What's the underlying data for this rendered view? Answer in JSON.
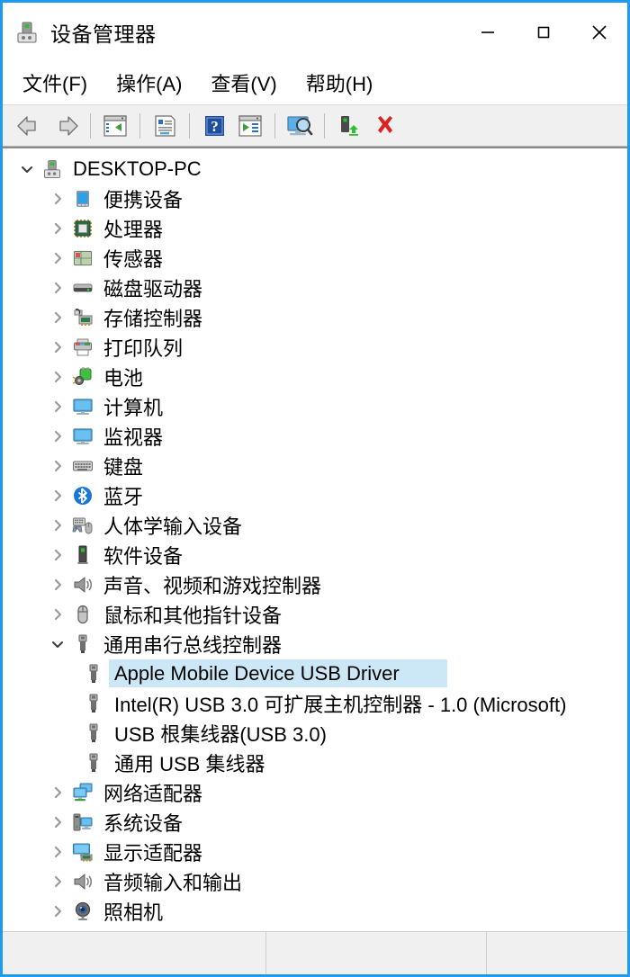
{
  "window": {
    "title": "设备管理器",
    "title_icon": "device-manager-icon",
    "border_color": "#1d9bf0",
    "controls": {
      "minimize": "−",
      "maximize": "□",
      "close": "✕"
    }
  },
  "menubar": {
    "items": [
      {
        "label": "文件(F)",
        "name": "menu-file"
      },
      {
        "label": "操作(A)",
        "name": "menu-action"
      },
      {
        "label": "查看(V)",
        "name": "menu-view"
      },
      {
        "label": "帮助(H)",
        "name": "menu-help"
      }
    ]
  },
  "toolbar": {
    "buttons": [
      {
        "name": "back-icon",
        "icon": "arrow-left"
      },
      {
        "name": "forward-icon",
        "icon": "arrow-right"
      },
      {
        "name": "separator",
        "icon": "sep"
      },
      {
        "name": "show-hide-console-tree-icon",
        "icon": "console-tree"
      },
      {
        "name": "separator",
        "icon": "sep"
      },
      {
        "name": "properties-icon",
        "icon": "properties"
      },
      {
        "name": "separator",
        "icon": "sep"
      },
      {
        "name": "help-icon",
        "icon": "help"
      },
      {
        "name": "update-driver-icon",
        "icon": "update-driver"
      },
      {
        "name": "separator",
        "icon": "sep"
      },
      {
        "name": "scan-hardware-changes-icon",
        "icon": "scan-monitor"
      },
      {
        "name": "separator",
        "icon": "sep"
      },
      {
        "name": "enable-device-icon",
        "icon": "enable-device"
      },
      {
        "name": "uninstall-device-icon",
        "icon": "red-x"
      }
    ]
  },
  "tree": {
    "selected_bg": "#cce8f6",
    "rows": [
      {
        "label": "DESKTOP-PC",
        "depth": 0,
        "state": "expanded",
        "icon": "computer-root-icon",
        "selected": false
      },
      {
        "label": "便携设备",
        "depth": 1,
        "state": "collapsed",
        "icon": "portable-device-icon",
        "selected": false
      },
      {
        "label": "处理器",
        "depth": 1,
        "state": "collapsed",
        "icon": "processor-icon",
        "selected": false
      },
      {
        "label": "传感器",
        "depth": 1,
        "state": "collapsed",
        "icon": "sensor-icon",
        "selected": false
      },
      {
        "label": "磁盘驱动器",
        "depth": 1,
        "state": "collapsed",
        "icon": "disk-drive-icon",
        "selected": false
      },
      {
        "label": "存储控制器",
        "depth": 1,
        "state": "collapsed",
        "icon": "storage-controller-icon",
        "selected": false
      },
      {
        "label": "打印队列",
        "depth": 1,
        "state": "collapsed",
        "icon": "printer-icon",
        "selected": false
      },
      {
        "label": "电池",
        "depth": 1,
        "state": "collapsed",
        "icon": "battery-icon",
        "selected": false
      },
      {
        "label": "计算机",
        "depth": 1,
        "state": "collapsed",
        "icon": "computer-icon",
        "selected": false
      },
      {
        "label": "监视器",
        "depth": 1,
        "state": "collapsed",
        "icon": "monitor-icon",
        "selected": false
      },
      {
        "label": "键盘",
        "depth": 1,
        "state": "collapsed",
        "icon": "keyboard-icon",
        "selected": false
      },
      {
        "label": "蓝牙",
        "depth": 1,
        "state": "collapsed",
        "icon": "bluetooth-icon",
        "selected": false
      },
      {
        "label": "人体学输入设备",
        "depth": 1,
        "state": "collapsed",
        "icon": "hid-icon",
        "selected": false
      },
      {
        "label": "软件设备",
        "depth": 1,
        "state": "collapsed",
        "icon": "software-device-icon",
        "selected": false
      },
      {
        "label": "声音、视频和游戏控制器",
        "depth": 1,
        "state": "collapsed",
        "icon": "sound-icon",
        "selected": false
      },
      {
        "label": "鼠标和其他指针设备",
        "depth": 1,
        "state": "collapsed",
        "icon": "mouse-icon",
        "selected": false
      },
      {
        "label": "通用串行总线控制器",
        "depth": 1,
        "state": "expanded",
        "icon": "usb-icon",
        "selected": false
      },
      {
        "label": "Apple Mobile Device USB Driver",
        "depth": 2,
        "state": "leaf",
        "icon": "usb-icon",
        "selected": true
      },
      {
        "label": "Intel(R) USB 3.0 可扩展主机控制器 - 1.0 (Microsoft)",
        "depth": 2,
        "state": "leaf",
        "icon": "usb-icon",
        "selected": false
      },
      {
        "label": "USB 根集线器(USB 3.0)",
        "depth": 2,
        "state": "leaf",
        "icon": "usb-icon",
        "selected": false
      },
      {
        "label": "通用 USB 集线器",
        "depth": 2,
        "state": "leaf",
        "icon": "usb-icon",
        "selected": false
      },
      {
        "label": "网络适配器",
        "depth": 1,
        "state": "collapsed",
        "icon": "network-adapter-icon",
        "selected": false
      },
      {
        "label": "系统设备",
        "depth": 1,
        "state": "collapsed",
        "icon": "system-device-icon",
        "selected": false
      },
      {
        "label": "显示适配器",
        "depth": 1,
        "state": "collapsed",
        "icon": "display-adapter-icon",
        "selected": false
      },
      {
        "label": "音频输入和输出",
        "depth": 1,
        "state": "collapsed",
        "icon": "audio-io-icon",
        "selected": false
      },
      {
        "label": "照相机",
        "depth": 1,
        "state": "collapsed",
        "icon": "camera-icon",
        "selected": false
      }
    ]
  },
  "statusbar": {
    "cells": [
      "",
      "",
      ""
    ]
  }
}
